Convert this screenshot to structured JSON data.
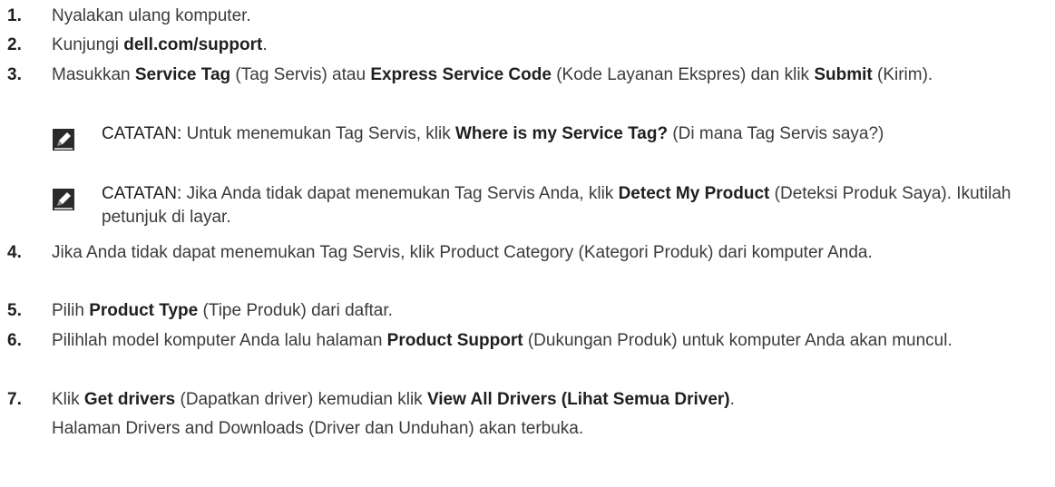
{
  "steps": [
    {
      "num": "1.",
      "parts": [
        {
          "t": "Nyalakan ulang komputer."
        }
      ]
    },
    {
      "num": "2.",
      "parts": [
        {
          "t": "Kunjungi "
        },
        {
          "t": "dell.com/support",
          "b": true
        },
        {
          "t": "."
        }
      ]
    },
    {
      "num": "3.",
      "parts": [
        {
          "t": "Masukkan "
        },
        {
          "t": "Service Tag",
          "b": true
        },
        {
          "t": " (Tag Servis) atau "
        },
        {
          "t": "Express Service Code",
          "b": true
        },
        {
          "t": " (Kode Layanan Ekspres) dan klik "
        },
        {
          "t": "Submit",
          "b": true
        },
        {
          "t": " (Kirim)."
        }
      ]
    },
    {
      "num": "4.",
      "parts": [
        {
          "t": "Jika Anda tidak dapat menemukan Tag Servis, klik Product Category (Kategori Produk) dari komputer Anda."
        }
      ]
    },
    {
      "num": "5.",
      "parts": [
        {
          "t": "Pilih "
        },
        {
          "t": "Product Type",
          "b": true
        },
        {
          "t": " (Tipe Produk) dari daftar."
        }
      ]
    },
    {
      "num": "6.",
      "parts": [
        {
          "t": "Pilihlah model komputer Anda lalu halaman "
        },
        {
          "t": "Product Support",
          "b": true
        },
        {
          "t": " (Dukungan Produk) untuk komputer Anda akan muncul."
        }
      ]
    },
    {
      "num": "7.",
      "parts": [
        {
          "t": "Klik "
        },
        {
          "t": "Get drivers",
          "b": true
        },
        {
          "t": " (Dapatkan driver) kemudian klik "
        },
        {
          "t": "View All Drivers (Lihat Semua Driver)",
          "b": true
        },
        {
          "t": "."
        }
      ]
    }
  ],
  "step7_followup": "Halaman Drivers and Downloads (Driver dan Unduhan) akan terbuka.",
  "notes": [
    {
      "label": "CATATAN:",
      "parts": [
        {
          "t": " Untuk menemukan Tag Servis, klik "
        },
        {
          "t": "Where is my Service Tag?",
          "b": true
        },
        {
          "t": " (Di mana Tag Servis saya?)"
        }
      ]
    },
    {
      "label": "CATATAN:",
      "parts": [
        {
          "t": " Jika Anda tidak dapat menemukan Tag Servis Anda, klik "
        },
        {
          "t": "Detect My Product",
          "b": true
        },
        {
          "t": " (Deteksi Produk Saya). Ikutilah petunjuk di layar."
        }
      ]
    }
  ],
  "icons": {
    "note": "pencil-note-icon"
  }
}
